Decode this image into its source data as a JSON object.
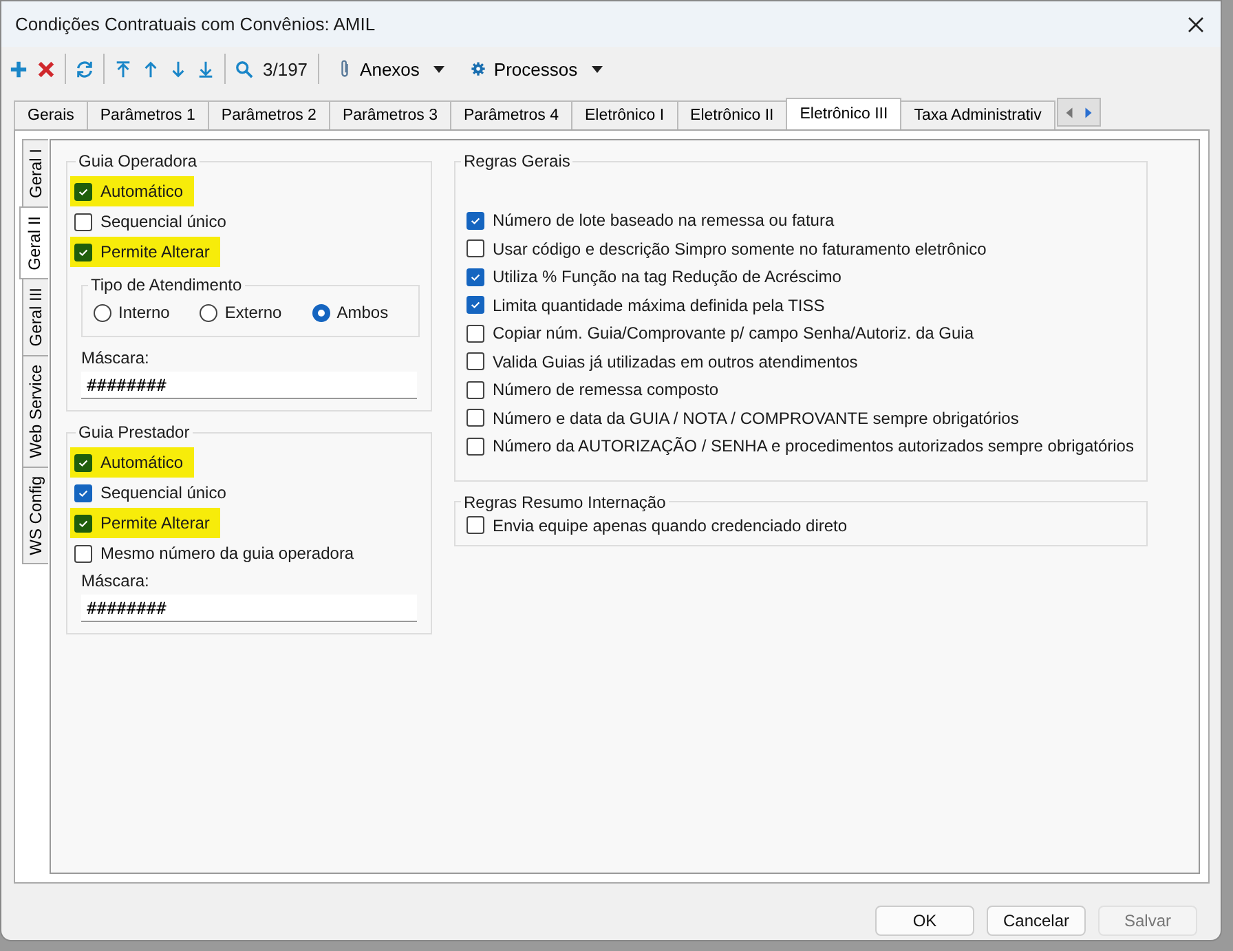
{
  "window": {
    "title": "Condições Contratuais com Convênios: AMIL"
  },
  "toolbar": {
    "counter": "3/197",
    "menus": [
      {
        "label": "Anexos",
        "kind": "attach"
      },
      {
        "label": "Processos",
        "kind": "gear"
      }
    ]
  },
  "tabs": [
    {
      "label": "Gerais",
      "selected": false
    },
    {
      "label": "Parâmetros 1",
      "selected": false
    },
    {
      "label": "Parâmetros 2",
      "selected": false
    },
    {
      "label": "Parâmetros 3",
      "selected": false
    },
    {
      "label": "Parâmetros 4",
      "selected": false
    },
    {
      "label": "Eletrônico I",
      "selected": false
    },
    {
      "label": "Eletrônico II",
      "selected": false
    },
    {
      "label": "Eletrônico III",
      "selected": true
    },
    {
      "label": "Taxa Administrativ",
      "selected": false
    }
  ],
  "side_tabs": [
    {
      "label": "Geral I",
      "selected": false
    },
    {
      "label": "Geral II",
      "selected": true
    },
    {
      "label": "Geral III",
      "selected": false
    },
    {
      "label": "Web Service",
      "selected": false
    },
    {
      "label": "WS Config",
      "selected": false
    }
  ],
  "guia_operadora": {
    "title": "Guia Operadora",
    "options": [
      {
        "label": "Automático",
        "checked": true,
        "highlighted": true
      },
      {
        "label": "Sequencial único",
        "checked": false,
        "highlighted": false
      },
      {
        "label": "Permite Alterar",
        "checked": true,
        "highlighted": true
      }
    ],
    "tipo_atendimento": {
      "title": "Tipo de Atendimento",
      "options": [
        {
          "label": "Interno",
          "selected": false
        },
        {
          "label": "Externo",
          "selected": false
        },
        {
          "label": "Ambos",
          "selected": true
        }
      ]
    },
    "mask": {
      "label": "Máscara:",
      "value": "########"
    }
  },
  "guia_prestador": {
    "title": "Guia Prestador",
    "options": [
      {
        "label": "Automático",
        "checked": true,
        "highlighted": true
      },
      {
        "label": "Sequencial único",
        "checked": true,
        "highlighted": false
      },
      {
        "label": "Permite Alterar",
        "checked": true,
        "highlighted": true
      },
      {
        "label": "Mesmo número da guia operadora",
        "checked": false,
        "highlighted": false
      }
    ],
    "mask": {
      "label": "Máscara:",
      "value": "########"
    }
  },
  "regras_gerais": {
    "title": "Regras Gerais",
    "options": [
      {
        "label": "Número de lote baseado na remessa ou fatura",
        "checked": true
      },
      {
        "label": "Usar código e descrição Simpro somente no faturamento eletrônico",
        "checked": false
      },
      {
        "label": "Utiliza % Função na tag Redução de Acréscimo",
        "checked": true
      },
      {
        "label": "Limita quantidade máxima definida pela TISS",
        "checked": true
      },
      {
        "label": "Copiar núm. Guia/Comprovante p/ campo Senha/Autoriz. da Guia",
        "checked": false
      },
      {
        "label": "Valida Guias já utilizadas em outros atendimentos",
        "checked": false
      },
      {
        "label": "Número de remessa composto",
        "checked": false
      },
      {
        "label": "Número e data da GUIA / NOTA / COMPROVANTE sempre obrigatórios",
        "checked": false
      },
      {
        "label": "Número da AUTORIZAÇÃO / SENHA e procedimentos autorizados sempre obrigatórios",
        "checked": false
      }
    ]
  },
  "regras_resumo": {
    "title": "Regras Resumo Internação",
    "options": [
      {
        "label": "Envia equipe apenas quando credenciado direto",
        "checked": false
      }
    ]
  },
  "buttons": [
    {
      "label": "OK",
      "disabled": false
    },
    {
      "label": "Cancelar",
      "disabled": false
    },
    {
      "label": "Salvar",
      "disabled": true
    }
  ]
}
